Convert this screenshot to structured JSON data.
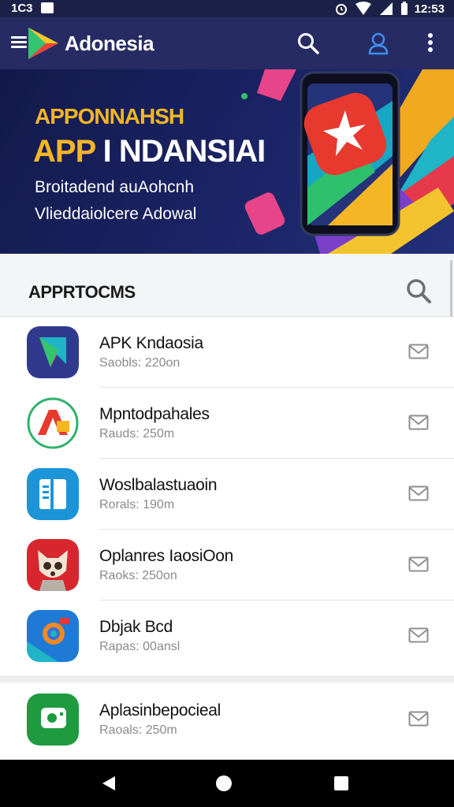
{
  "status_bar": {
    "time_left": "1C3",
    "time_right": "12:53"
  },
  "app_bar": {
    "title": "Adonesia",
    "icons": [
      "menu-icon",
      "play-logo-icon",
      "search-icon",
      "account-icon",
      "more-vert-icon"
    ]
  },
  "banner": {
    "line1": "APPONNAHSH",
    "line2_part1": "APP",
    "line2_part2": "I NDANSIAI",
    "line3": "Broitadend auAohcnh",
    "line4": "Vlieddaiolcere Adowal"
  },
  "section": {
    "title": "APPRTOCMS"
  },
  "apps": [
    {
      "name": "APK Kndaosia",
      "meta": "Saobls: 220on",
      "icon": "play-logo-icon"
    },
    {
      "name": "Mpntodpahales",
      "meta": "Rauds: 250m",
      "icon": "red-a-logo-icon"
    },
    {
      "name": "Woslbalastuaoin",
      "meta": "Rorals: 190m",
      "icon": "book-icon"
    },
    {
      "name": "Oplanres IaosiOon",
      "meta": "Raoks: 250on",
      "icon": "fox-mascot-icon"
    },
    {
      "name": "Dbjak Bcd",
      "meta": "Rapas: 00ansl",
      "icon": "camera-icon"
    },
    {
      "name": "Aplasinbepocieal",
      "meta": "Raoals: 250m",
      "icon": "green-app-icon"
    }
  ],
  "colors": {
    "app_bar": "#262c63",
    "status_bar": "#1c2247",
    "banner_accent": "#f5b626"
  }
}
